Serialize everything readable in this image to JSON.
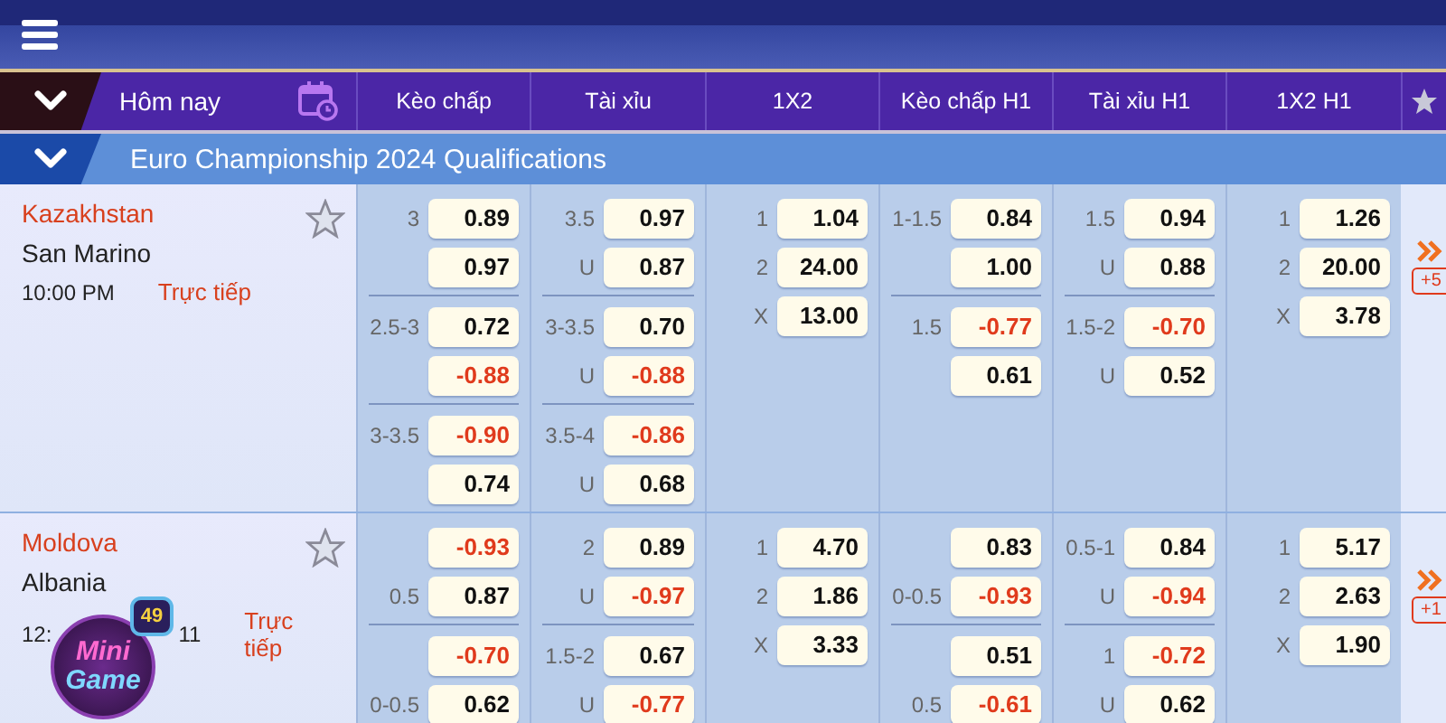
{
  "header": {
    "date_label": "Hôm nay",
    "columns": [
      "Kèo chấp",
      "Tài xỉu",
      "1X2",
      "Kèo chấp H1",
      "Tài xỉu H1",
      "1X2 H1"
    ]
  },
  "league": {
    "title": "Euro Championship 2024 Qualifications"
  },
  "matches": [
    {
      "home": "Kazakhstan",
      "away": "San Marino",
      "time_parts": [
        "10:00 PM"
      ],
      "status": "Trực tiếp",
      "more": "+5",
      "markets": [
        [
          [
            {
              "label": "3",
              "odd": "0.89",
              "negative": false
            },
            {
              "odd": "0.97",
              "negative": false
            }
          ],
          [
            {
              "label": "2.5-3",
              "odd": "0.72",
              "negative": false
            },
            {
              "odd": "-0.88",
              "negative": true
            }
          ],
          [
            {
              "label": "3-3.5",
              "odd": "-0.90",
              "negative": true
            },
            {
              "odd": "0.74",
              "negative": false
            }
          ]
        ],
        [
          [
            {
              "label": "3.5",
              "odd": "0.97",
              "negative": false
            },
            {
              "label": "U",
              "odd": "0.87",
              "negative": false
            }
          ],
          [
            {
              "label": "3-3.5",
              "odd": "0.70",
              "negative": false
            },
            {
              "label": "U",
              "odd": "-0.88",
              "negative": true
            }
          ],
          [
            {
              "label": "3.5-4",
              "odd": "-0.86",
              "negative": true
            },
            {
              "label": "U",
              "odd": "0.68",
              "negative": false
            }
          ]
        ],
        [
          [
            {
              "label": "1",
              "odd": "1.04",
              "negative": false
            },
            {
              "label": "2",
              "odd": "24.00",
              "negative": false
            },
            {
              "label": "X",
              "odd": "13.00",
              "negative": false
            }
          ]
        ],
        [
          [
            {
              "label": "1-1.5",
              "odd": "0.84",
              "negative": false
            },
            {
              "odd": "1.00",
              "negative": false
            }
          ],
          [
            {
              "label": "1.5",
              "odd": "-0.77",
              "negative": true
            },
            {
              "odd": "0.61",
              "negative": false
            }
          ]
        ],
        [
          [
            {
              "label": "1.5",
              "odd": "0.94",
              "negative": false
            },
            {
              "label": "U",
              "odd": "0.88",
              "negative": false
            }
          ],
          [
            {
              "label": "1.5-2",
              "odd": "-0.70",
              "negative": true
            },
            {
              "label": "U",
              "odd": "0.52",
              "negative": false
            }
          ]
        ],
        [
          [
            {
              "label": "1",
              "odd": "1.26",
              "negative": false
            },
            {
              "label": "2",
              "odd": "20.00",
              "negative": false
            },
            {
              "label": "X",
              "odd": "3.78",
              "negative": false
            }
          ]
        ]
      ]
    },
    {
      "home": "Moldova",
      "away": "Albania",
      "time_parts": [
        "12:",
        "11"
      ],
      "status": "Trực tiếp",
      "more": "+1",
      "markets": [
        [
          [
            {
              "odd": "-0.93",
              "negative": true
            },
            {
              "label": "0.5",
              "odd": "0.87",
              "negative": false
            }
          ],
          [
            {
              "odd": "-0.70",
              "negative": true
            },
            {
              "label": "0-0.5",
              "odd": "0.62",
              "negative": false
            }
          ]
        ],
        [
          [
            {
              "label": "2",
              "odd": "0.89",
              "negative": false
            },
            {
              "label": "U",
              "odd": "-0.97",
              "negative": true
            }
          ],
          [
            {
              "label": "1.5-2",
              "odd": "0.67",
              "negative": false
            },
            {
              "label": "U",
              "odd": "-0.77",
              "negative": true
            }
          ]
        ],
        [
          [
            {
              "label": "1",
              "odd": "4.70",
              "negative": false
            },
            {
              "label": "2",
              "odd": "1.86",
              "negative": false
            },
            {
              "label": "X",
              "odd": "3.33",
              "negative": false
            }
          ]
        ],
        [
          [
            {
              "odd": "0.83",
              "negative": false
            },
            {
              "label": "0-0.5",
              "odd": "-0.93",
              "negative": true
            }
          ],
          [
            {
              "odd": "0.51",
              "negative": false
            },
            {
              "label": "0.5",
              "odd": "-0.61",
              "negative": true
            }
          ]
        ],
        [
          [
            {
              "label": "0.5-1",
              "odd": "0.84",
              "negative": false
            },
            {
              "label": "U",
              "odd": "-0.94",
              "negative": true
            }
          ],
          [
            {
              "label": "1",
              "odd": "-0.72",
              "negative": true
            },
            {
              "label": "U",
              "odd": "0.62",
              "negative": false
            }
          ]
        ],
        [
          [
            {
              "label": "1",
              "odd": "5.17",
              "negative": false
            },
            {
              "label": "2",
              "odd": "2.63",
              "negative": false
            },
            {
              "label": "X",
              "odd": "1.90",
              "negative": false
            }
          ]
        ]
      ]
    }
  ],
  "overlay": {
    "title_lines": [
      "Mini",
      "Game"
    ],
    "badge": "49"
  }
}
